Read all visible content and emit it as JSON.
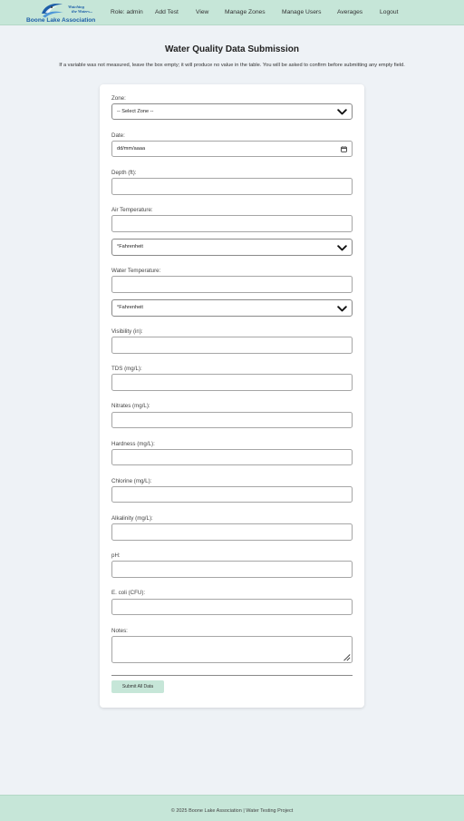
{
  "header": {
    "logo_tagline_line1": "Watching",
    "logo_tagline_line2": "the Waters...",
    "logo_name": "Boone Lake Association",
    "role": "Role: admin",
    "nav": [
      "Add Test",
      "View",
      "Manage Zones",
      "Manage Users",
      "Averages",
      "Logout"
    ]
  },
  "page": {
    "title": "Water Quality Data Submission",
    "instructions": "If a variable was not measured, leave the box empty; it will produce no value in the table. You will be asked to confirm before submitting any empty field."
  },
  "form": {
    "zone": {
      "label": "Zone:",
      "selected": "-- Select Zone --"
    },
    "date": {
      "label": "Date:",
      "placeholder": "dd/mm/aaaa"
    },
    "depth": {
      "label": "Depth (ft):"
    },
    "air_temperature": {
      "label": "Air Temperature:",
      "unit": "°Fahrenheit"
    },
    "water_temperature": {
      "label": "Water Temperature:",
      "unit": "°Fahrenheit"
    },
    "visibility": {
      "label": "Visibility (in):"
    },
    "tds": {
      "label": "TDS (mg/L):"
    },
    "nitrates": {
      "label": "Nitrates (mg/L):"
    },
    "hardness": {
      "label": "Hardness (mg/L):"
    },
    "chlorine": {
      "label": "Chlorine (mg/L):"
    },
    "alkalinity": {
      "label": "Alkalinity (mg/L):"
    },
    "ph": {
      "label": "pH:"
    },
    "ecoli": {
      "label": "E. coli (CFU):"
    },
    "notes": {
      "label": "Notes:"
    },
    "submit_label": "Submit All Data"
  },
  "footer": {
    "text": "© 2025 Boone Lake Association | Water Testing Project"
  },
  "icons": {
    "logo": "lake-logo-icon",
    "select": "chevron-down-icon",
    "date": "calendar-icon",
    "textarea": "resize-grip-icon"
  },
  "colors": {
    "header_bg": "#c6e6d8",
    "page_bg": "#eef2f6",
    "brand_blue": "#1d5ea8",
    "button_bg": "#c6e6d8"
  }
}
